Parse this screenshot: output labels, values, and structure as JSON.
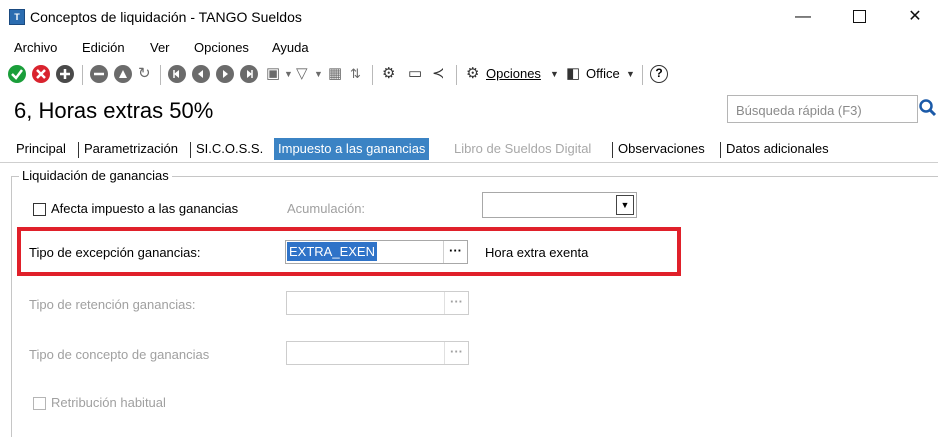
{
  "window": {
    "title": "Conceptos de liquidación - TANGO Sueldos",
    "icon": "app-logo-icon",
    "controls": [
      "minimize-icon",
      "maximize-icon",
      "close-icon"
    ]
  },
  "menu": {
    "items": [
      "Archivo",
      "Edición",
      "Ver",
      "Opciones",
      "Ayuda"
    ]
  },
  "toolbar": {
    "opciones_label": "Opciones",
    "office_label": "Office",
    "help_icon": "help-icon",
    "colors": {
      "accept": "#1a9e3a",
      "cancel": "#d9232e",
      "add": "#4a4a4a"
    }
  },
  "record": {
    "title": "6, Horas extras  50%"
  },
  "search": {
    "placeholder": "Búsqueda rápida (F3)"
  },
  "tabs": [
    {
      "label": "Principal",
      "state": "normal"
    },
    {
      "label": "Parametrización",
      "state": "normal"
    },
    {
      "label": "SI.C.O.S.S.",
      "state": "normal"
    },
    {
      "label": "Impuesto a las ganancias",
      "state": "active"
    },
    {
      "label": "Libro de Sueldos Digital",
      "state": "disabled"
    },
    {
      "label": "Observaciones",
      "state": "normal"
    },
    {
      "label": "Datos adicionales",
      "state": "normal"
    }
  ],
  "ganancias": {
    "group_label": "Liquidación de ganancias",
    "afecta_label": "Afecta impuesto a las ganancias",
    "afecta_checked": false,
    "acumulacion_label": "Acumulación:",
    "acumulacion_value": "",
    "excepcion_label": "Tipo de excepción ganancias:",
    "excepcion_code": "EXTRA_EXEN",
    "excepcion_desc": "Hora extra exenta",
    "retencion_label": "Tipo de retención ganancias:",
    "concepto_label": "Tipo de concepto de ganancias",
    "retribucion_label": "Retribución habitual",
    "retribucion_checked": false,
    "ellipsis": "···",
    "highlight_color": "#e0202a"
  }
}
